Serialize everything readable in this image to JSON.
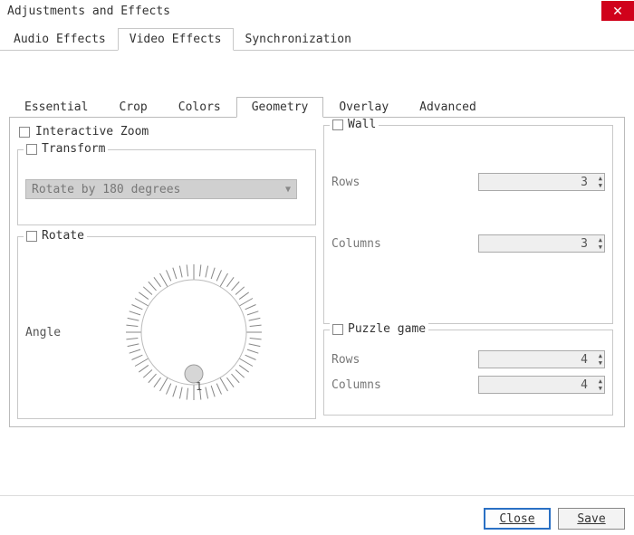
{
  "window": {
    "title": "Adjustments and Effects"
  },
  "mainTabs": {
    "t0": "Audio Effects",
    "t1": "Video Effects",
    "t2": "Synchronization",
    "activeIndex": 1
  },
  "subTabs": {
    "s0": "Essential",
    "s1": "Crop",
    "s2": "Colors",
    "s3": "Geometry",
    "s4": "Overlay",
    "s5": "Advanced",
    "activeIndex": 3
  },
  "geometry": {
    "interactiveZoom": {
      "label": "Interactive Zoom",
      "checked": false
    },
    "transform": {
      "label": "Transform",
      "checked": false,
      "selected": "Rotate by 180 degrees"
    },
    "rotate": {
      "label": "Rotate",
      "checked": false,
      "angleLabel": "Angle",
      "angleValue": 0,
      "tickOne": "1"
    },
    "wall": {
      "label": "Wall",
      "checked": false,
      "rowsLabel": "Rows",
      "rowsValue": 3,
      "colsLabel": "Columns",
      "colsValue": 3
    },
    "puzzle": {
      "label": "Puzzle game",
      "checked": false,
      "rowsLabel": "Rows",
      "rowsValue": 4,
      "colsLabel": "Columns",
      "colsValue": 4
    }
  },
  "buttons": {
    "close": "Close",
    "save": "Save"
  },
  "icons": {
    "close": "✕",
    "dropdown": "▼",
    "spinUp": "▲",
    "spinDown": "▼"
  }
}
